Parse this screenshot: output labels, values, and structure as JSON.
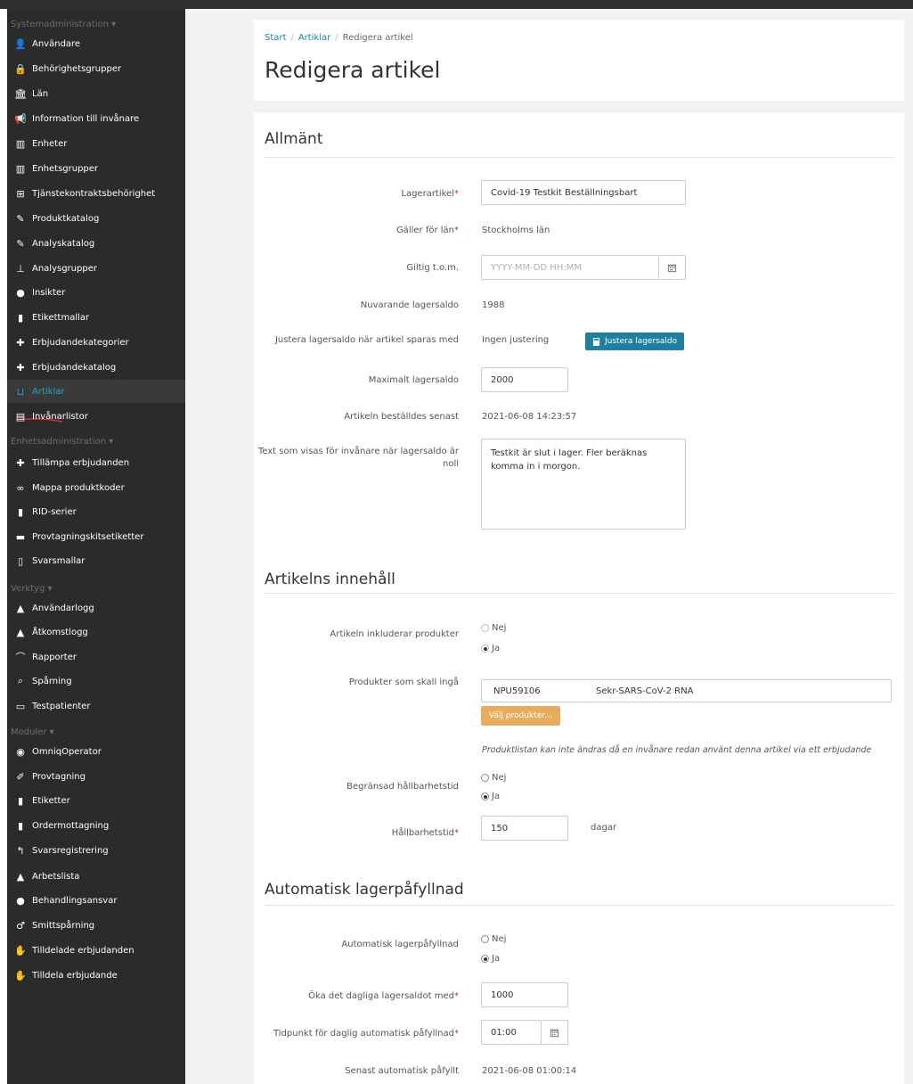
{
  "colors": {
    "accent": "#2aa3c7",
    "sidebar_bg": "#2b2b2b",
    "teal_button": "#1f7f9e",
    "orange_button": "#e8ac5e",
    "required": "#c9302c"
  },
  "sidebar": {
    "sections": [
      {
        "label": "Systemadministration ▾"
      },
      {
        "label": "Enhetsadministration ▾"
      },
      {
        "label": "Verktyg ▾"
      },
      {
        "label": "Moduler ▾"
      }
    ],
    "items": [
      {
        "label": "Användare",
        "icon": "user-icon"
      },
      {
        "label": "Behörighetsgrupper",
        "icon": "lock-icon"
      },
      {
        "label": "Län",
        "icon": "institution-icon"
      },
      {
        "label": "Information till invånare",
        "icon": "bullhorn-icon"
      },
      {
        "label": "Enheter",
        "icon": "building-icon"
      },
      {
        "label": "Enhetsgrupper",
        "icon": "buildings-icon"
      },
      {
        "label": "Tjänstekontraktsbehörighet",
        "icon": "sitemap-icon"
      },
      {
        "label": "Produktkatalog",
        "icon": "pencil-icon"
      },
      {
        "label": "Analyskatalog",
        "icon": "pencil-icon"
      },
      {
        "label": "Analysgrupper",
        "icon": "flask-group-icon"
      },
      {
        "label": "Insikter",
        "icon": "lightbulb-icon"
      },
      {
        "label": "Etikettmallar",
        "icon": "barcode-icon"
      },
      {
        "label": "Erbjudandekategorier",
        "icon": "gift-icon"
      },
      {
        "label": "Erbjudandekatalog",
        "icon": "gift-icon"
      },
      {
        "label": "Artiklar",
        "icon": "cart-icon"
      },
      {
        "label": "Invånarlistor",
        "icon": "list-icon"
      },
      {
        "label": "Tillämpa erbjudanden",
        "icon": "gift-icon"
      },
      {
        "label": "Mappa produktkoder",
        "icon": "link-icon"
      },
      {
        "label": "RID-serier",
        "icon": "barcode-icon"
      },
      {
        "label": "Provtagningskitsetiketter",
        "icon": "tag-icon"
      },
      {
        "label": "Svarsmallar",
        "icon": "file-icon"
      },
      {
        "label": "Användarlogg",
        "icon": "log-icon"
      },
      {
        "label": "Åtkomstlogg",
        "icon": "log-icon"
      },
      {
        "label": "Rapporter",
        "icon": "chart-icon"
      },
      {
        "label": "Spårning",
        "icon": "search-icon"
      },
      {
        "label": "Testpatienter",
        "icon": "id-card-icon"
      },
      {
        "label": "OmniqOperator",
        "icon": "operator-icon"
      },
      {
        "label": "Provtagning",
        "icon": "syringe-icon"
      },
      {
        "label": "Etiketter",
        "icon": "barcode-icon"
      },
      {
        "label": "Ordermottagning",
        "icon": "barcode-icon"
      },
      {
        "label": "Svarsregistrering",
        "icon": "reply-icon"
      },
      {
        "label": "Arbetslista",
        "icon": "warning-icon"
      },
      {
        "label": "Behandlingsansvar",
        "icon": "users-icon"
      },
      {
        "label": "Smittspårning",
        "icon": "contact-icon"
      },
      {
        "label": "Tilldelade erbjudanden",
        "icon": "hand-icon"
      },
      {
        "label": "Tilldela erbjudande",
        "icon": "hand-icon"
      }
    ]
  },
  "breadcrumb": {
    "start": "Start",
    "articles": "Artiklar",
    "separator": "/",
    "current": "Redigera artikel"
  },
  "page_title": "Redigera artikel",
  "sections": {
    "general": {
      "title": "Allmänt",
      "stock_article_label": "Lagerartikel",
      "stock_article_value": "Covid-19 Testkit Beställningsbart",
      "county_label": "Gäller för län",
      "county_value": "Stockholms län",
      "valid_until_label": "Giltig t.o.m.",
      "valid_until_placeholder": "YYYY-MM-DD HH:MM",
      "current_stock_label": "Nuvarande lagersaldo",
      "current_stock_value": "1988",
      "adjust_label": "Justera lagersaldo när artikel sparas med",
      "adjust_value": "Ingen justering",
      "adjust_button": "Justera lagersaldo",
      "max_stock_label": "Maximalt lagersaldo",
      "max_stock_value": "2000",
      "last_ordered_label": "Artikeln beställdes senast",
      "last_ordered_value": "2021-06-08 14:23:57",
      "zero_text_label": "Text som visas för invånare när lagersaldo är noll",
      "zero_text_value": "Testkit är slut i lager.  Fler beräknas komma in i morgon."
    },
    "content": {
      "title": "Artikelns innehåll",
      "includes_label": "Artikeln inkluderar produkter",
      "opt_no": "Nej",
      "opt_yes": "Ja",
      "products_label": "Produkter som skall ingå",
      "product_code": "NPU59106",
      "product_name": "Sekr-SARS-CoV-2 RNA",
      "choose_button": "Välj produkter...",
      "note": "Produktlistan kan inte ändras då en invånare redan använt denna artikel via ett erbjudande",
      "limited_label": "Begränsad hållbarhetstid",
      "shelf_life_label": "Hållbarhetstid",
      "shelf_life_value": "150",
      "shelf_life_unit": "dagar"
    },
    "refill": {
      "title": "Automatisk lagerpåfyllnad",
      "auto_label": "Automatisk lagerpåfyllnad",
      "increase_label": "Öka det dagliga lagersaldot med",
      "increase_value": "1000",
      "time_label": "Tidpunkt för daglig automatisk påfyllnad",
      "time_value": "01:00",
      "last_label": "Senast automatisk påfyllt",
      "last_value": "2021-06-08 01:00:14"
    }
  },
  "required_mark": "*"
}
